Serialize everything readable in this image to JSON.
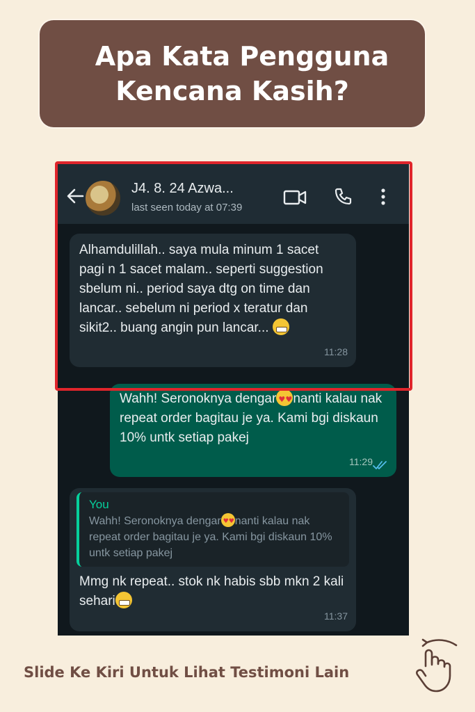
{
  "header": {
    "title_line1": "Apa Kata Pengguna",
    "title_line2": "Kencana Kasih?"
  },
  "chat": {
    "contact_name": "J4. 8. 24 Azwa...",
    "status": "last seen today at 07:39",
    "icons": [
      "back-arrow-icon",
      "avatar",
      "video-call-icon",
      "phone-icon",
      "more-options-icon"
    ],
    "messages": [
      {
        "direction": "incoming",
        "text": "Alhamdulillah.. saya mula minum 1 sacet pagi n 1 sacet malam.. seperti suggestion sbelum ni.. period saya dtg on time dan lancar.. sebelum ni period x teratur dan sikit2.. buang angin pun lancar...",
        "emoji": "grimacing-face",
        "time": "11:28"
      },
      {
        "direction": "outgoing",
        "text_before_emoji": "Wahh! Seronoknya dengar",
        "emoji": "heart-eyes-face",
        "text_after_emoji": "nanti kalau nak repeat order bagitau je ya. Kami bgi diskaun 10% untk setiap pakej",
        "time": "11:29",
        "read_receipt": "double-check-blue"
      },
      {
        "direction": "incoming",
        "quoted_author": "You",
        "quoted_before_emoji": "Wahh! Seronoknya dengar",
        "quoted_emoji": "heart-eyes-face",
        "quoted_after_emoji": "nanti kalau nak repeat order bagitau je ya. Kami bgi diskaun 10% untk setiap pakej",
        "text": "Mmg nk repeat.. stok nk habis sbb mkn 2 kali sehari",
        "emoji": "grimacing-face",
        "time": "11:37"
      }
    ]
  },
  "highlight_color": "#e0252b",
  "footer": {
    "text": "Slide Ke Kiri Untuk Lihat Testimoni Lain",
    "icon": "swipe-hand-icon"
  },
  "colors": {
    "background": "#f8eedd",
    "brand_brown": "#704e44",
    "whatsapp_header": "#1f2c34",
    "incoming_bubble": "#202c33",
    "outgoing_bubble": "#005c4b"
  }
}
